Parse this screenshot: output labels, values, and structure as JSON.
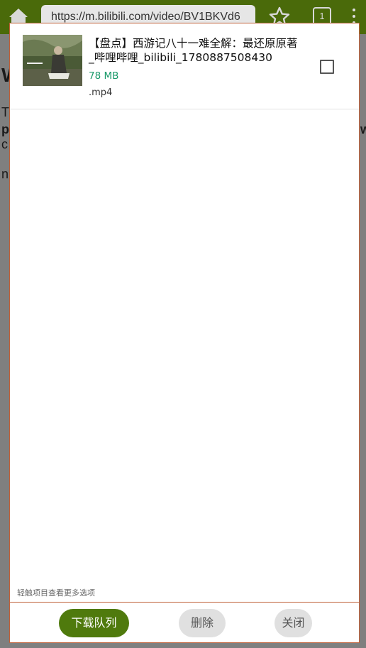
{
  "browser": {
    "url": "https://m.bilibili.com/video/BV1BKVd6",
    "tab_count": "1"
  },
  "background_fragments": [
    "W",
    "T",
    "p",
    "c",
    "n",
    "w"
  ],
  "download_item": {
    "title": "【盘点】西游记八十一难全解：最还原原著_哔哩哔哩_bilibili_1780887508430",
    "size": "78 MB",
    "extension": ".mp4",
    "checked": false
  },
  "hint": "轻触项目查看更多选项",
  "buttons": {
    "queue": "下载队列",
    "delete": "删除",
    "close": "关闭"
  },
  "colors": {
    "toolbar": "#4a6a0a",
    "primary_button": "#4f7a0d",
    "size_text": "#1a9a6a",
    "dialog_border": "#c0613a"
  }
}
